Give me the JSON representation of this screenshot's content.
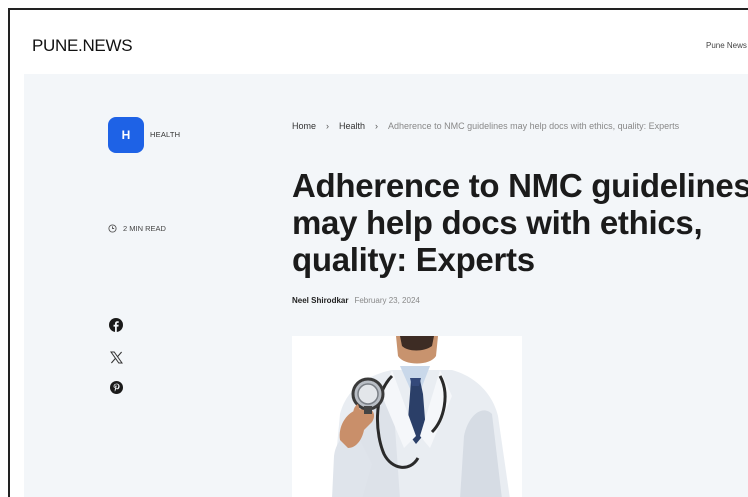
{
  "site": {
    "logo": "PUNE.NEWS",
    "nav_item": "Pune News"
  },
  "category": {
    "badge_letter": "H",
    "label": "HEALTH",
    "color": "#1e62e6"
  },
  "read_time": "2 MIN READ",
  "social": {
    "icons": [
      "facebook-icon",
      "x-icon",
      "pinterest-icon"
    ]
  },
  "breadcrumb": {
    "home": "Home",
    "separator": "›",
    "section": "Health",
    "current": "Adherence to NMC guidelines may help docs with ethics, quality: Experts"
  },
  "article": {
    "title": "Adherence to NMC guidelines may help docs with ethics, quality: Experts",
    "author": "Neel Shirodkar",
    "date": "February 23, 2024"
  }
}
